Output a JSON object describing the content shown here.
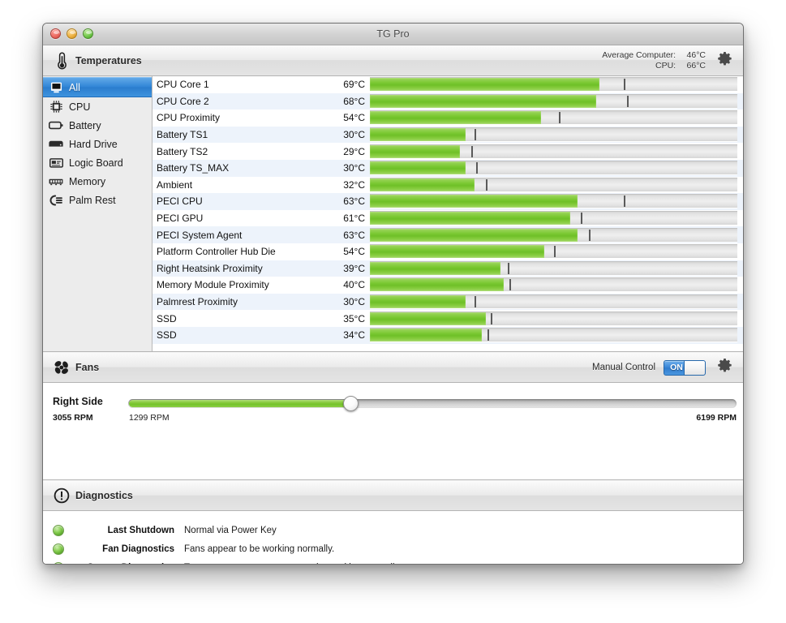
{
  "window": {
    "title": "TG Pro",
    "traffic_lights": [
      "close-button",
      "minimize-button",
      "zoom-button"
    ]
  },
  "temperatures": {
    "header_title": "Temperatures",
    "header_icon": "thermometer-icon",
    "settings_icon": "gear-icon",
    "average": {
      "computer_label": "Average Computer:",
      "computer_value": "46°C",
      "cpu_label": "CPU:",
      "cpu_value": "66°C"
    },
    "sidebar": [
      {
        "label": "All",
        "icon": "computer-icon",
        "selected": true
      },
      {
        "label": "CPU",
        "icon": "cpu-chip-icon",
        "selected": false
      },
      {
        "label": "Battery",
        "icon": "battery-icon",
        "selected": false
      },
      {
        "label": "Hard Drive",
        "icon": "hard-drive-icon",
        "selected": false
      },
      {
        "label": "Logic Board",
        "icon": "logic-board-icon",
        "selected": false
      },
      {
        "label": "Memory",
        "icon": "memory-ram-icon",
        "selected": false
      },
      {
        "label": "Palm Rest",
        "icon": "palm-rest-icon",
        "selected": false
      }
    ],
    "sensors": [
      {
        "name": "CPU Core 1",
        "value": "69°C",
        "bar_pct": 62.5,
        "peak_pct": 69.0
      },
      {
        "name": "CPU Core 2",
        "value": "68°C",
        "bar_pct": 61.5,
        "peak_pct": 70.0
      },
      {
        "name": "CPU Proximity",
        "value": "54°C",
        "bar_pct": 46.5,
        "peak_pct": 51.5
      },
      {
        "name": "Battery TS1",
        "value": "30°C",
        "bar_pct": 26.0,
        "peak_pct": 28.5
      },
      {
        "name": "Battery TS2",
        "value": "29°C",
        "bar_pct": 24.5,
        "peak_pct": 27.5
      },
      {
        "name": "Battery TS_MAX",
        "value": "30°C",
        "bar_pct": 26.0,
        "peak_pct": 29.0
      },
      {
        "name": "Ambient",
        "value": "32°C",
        "bar_pct": 28.5,
        "peak_pct": 31.5
      },
      {
        "name": "PECI CPU",
        "value": "63°C",
        "bar_pct": 56.5,
        "peak_pct": 69.0
      },
      {
        "name": "PECI GPU",
        "value": "61°C",
        "bar_pct": 54.5,
        "peak_pct": 57.5
      },
      {
        "name": "PECI System Agent",
        "value": "63°C",
        "bar_pct": 56.5,
        "peak_pct": 59.5
      },
      {
        "name": "Platform Controller Hub Die",
        "value": "54°C",
        "bar_pct": 47.5,
        "peak_pct": 50.0
      },
      {
        "name": "Right Heatsink Proximity",
        "value": "39°C",
        "bar_pct": 35.5,
        "peak_pct": 37.5
      },
      {
        "name": "Memory Module Proximity",
        "value": "40°C",
        "bar_pct": 36.5,
        "peak_pct": 38.0
      },
      {
        "name": "Palmrest Proximity",
        "value": "30°C",
        "bar_pct": 26.0,
        "peak_pct": 28.5
      },
      {
        "name": "SSD",
        "value": "35°C",
        "bar_pct": 31.5,
        "peak_pct": 33.0
      },
      {
        "name": "SSD",
        "value": "34°C",
        "bar_pct": 30.5,
        "peak_pct": 32.0
      }
    ]
  },
  "fans": {
    "header_title": "Fans",
    "header_icon": "fan-icon",
    "settings_icon": "gear-icon",
    "manual_control_label": "Manual Control",
    "manual_control_state": "ON",
    "fan": {
      "name": "Right Side",
      "current_rpm": "3055 RPM",
      "min_rpm": "1299 RPM",
      "max_rpm": "6199 RPM",
      "slider_pct": 36.5
    }
  },
  "diagnostics": {
    "header_title": "Diagnostics",
    "header_icon": "exclamation-circle-icon",
    "items": [
      {
        "label": "Last Shutdown",
        "text": "Normal via Power Key",
        "status": "ok"
      },
      {
        "label": "Fan Diagnostics",
        "text": "Fans appear to be working normally.",
        "status": "ok"
      },
      {
        "label": "Sensor Diagnostics",
        "text": "Temperature sensors appear to be working normally.",
        "status": "ok"
      }
    ]
  },
  "colors": {
    "bar_green": "#7ac832",
    "accent_blue": "#2f84d6",
    "led_green": "#84cc4e"
  }
}
